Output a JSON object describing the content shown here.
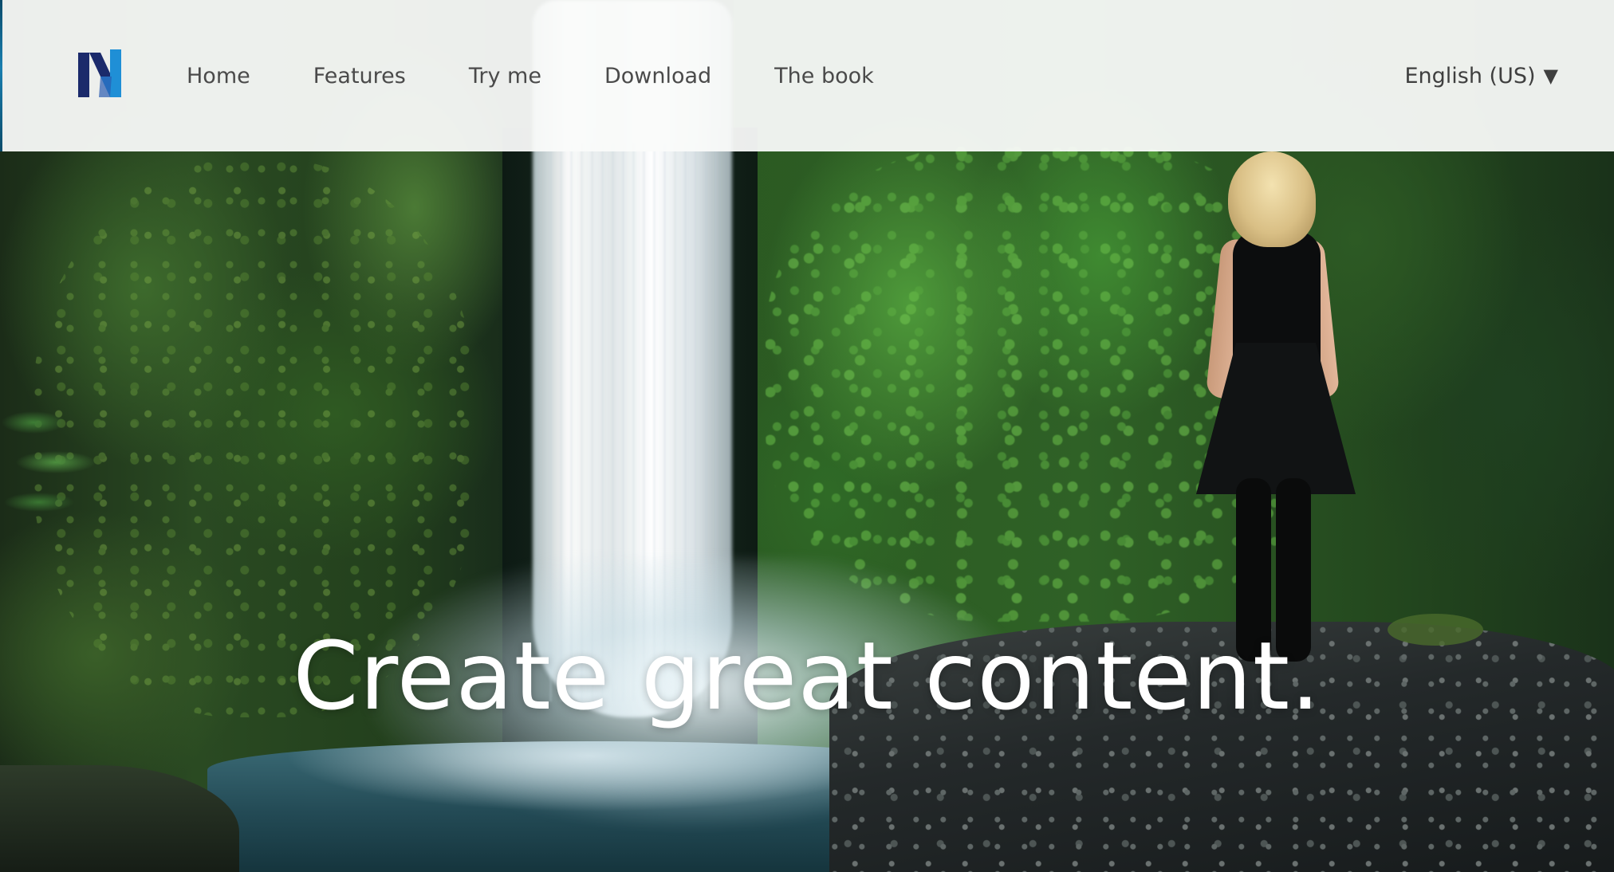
{
  "brand": {
    "logo_letter": "N",
    "colors": {
      "logo_dark": "#1b2a6b",
      "logo_light": "#1f8fd6"
    }
  },
  "nav": {
    "items": [
      {
        "label": "Home"
      },
      {
        "label": "Features"
      },
      {
        "label": "Try me"
      },
      {
        "label": "Download"
      },
      {
        "label": "The book"
      }
    ]
  },
  "language": {
    "selected": "English (US)",
    "caret": "▼"
  },
  "hero": {
    "headline": "Create great content."
  },
  "icons": {
    "logo": "n-logo-icon",
    "caret": "chevron-down-icon"
  }
}
